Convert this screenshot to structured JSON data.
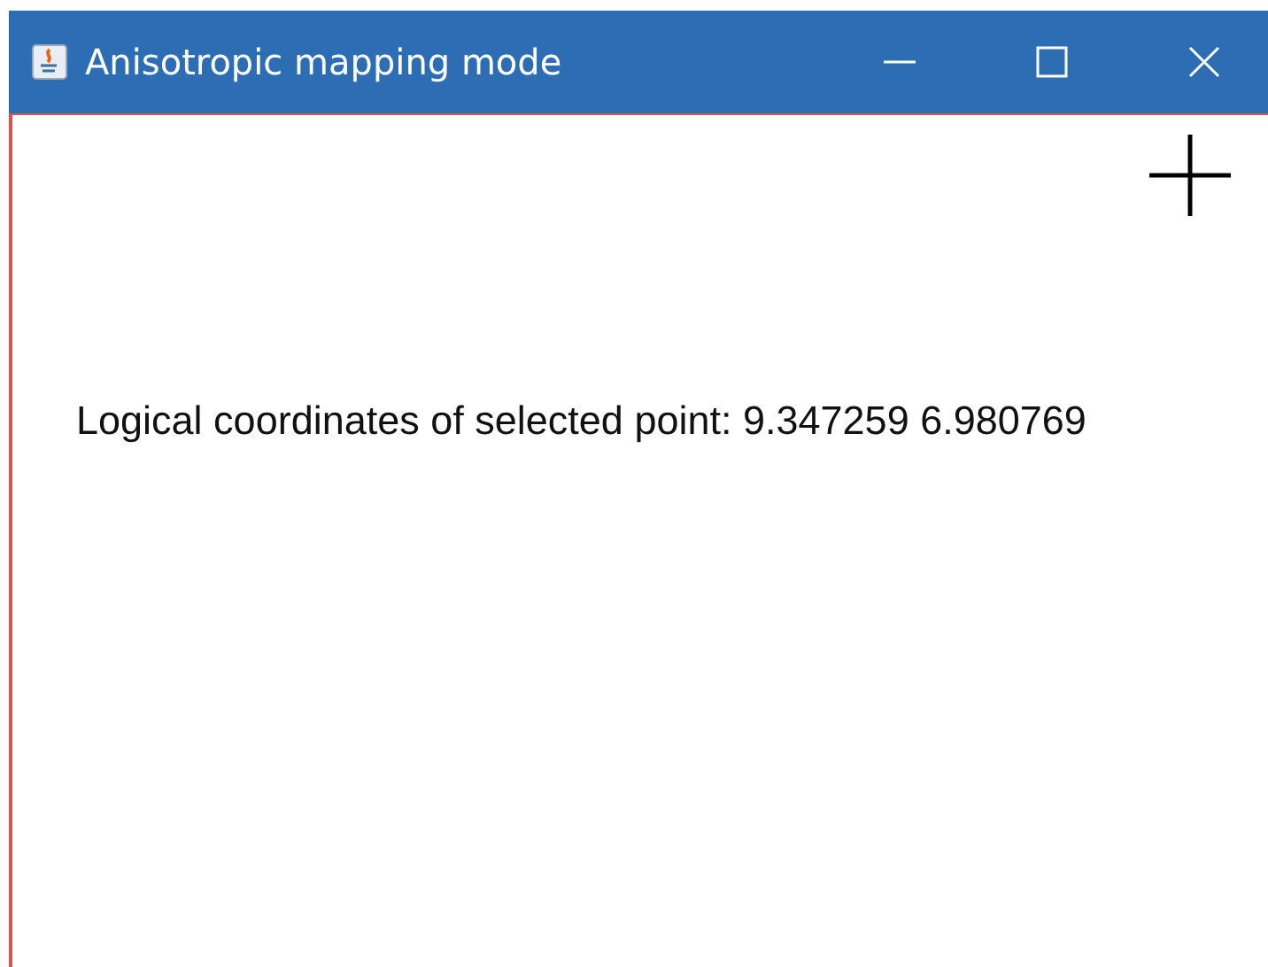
{
  "window": {
    "title": "Anisotropic mapping mode"
  },
  "canvas": {
    "message": "Logical coordinates of selected point: 9.347259 6.980769"
  }
}
